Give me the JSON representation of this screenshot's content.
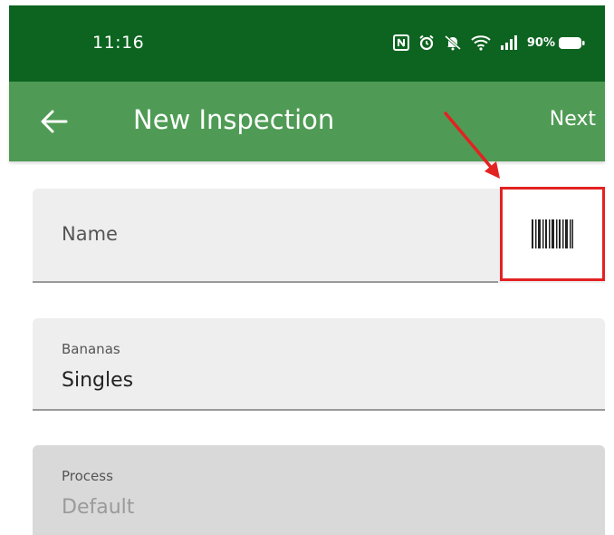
{
  "status_bar": {
    "time": "11:16",
    "battery_percent": "90%",
    "icons": [
      "nfc-icon",
      "alarm-icon",
      "mute-icon",
      "wifi-icon",
      "signal-icon",
      "battery-icon"
    ]
  },
  "app_bar": {
    "title": "New Inspection",
    "next_label": "Next",
    "back_icon": "arrow-left-icon"
  },
  "form": {
    "name_field": {
      "placeholder": "Name",
      "scan_icon": "barcode-icon"
    },
    "bananas_field": {
      "label": "Bananas",
      "value": "Singles"
    },
    "process_field": {
      "label": "Process",
      "value": "Default"
    }
  },
  "colors": {
    "status_bar": "#0d6420",
    "app_bar": "#4f9b55",
    "field_bg": "#eeeeee",
    "disabled_field_bg": "#d9d9d9",
    "annotation": "#e32222"
  }
}
